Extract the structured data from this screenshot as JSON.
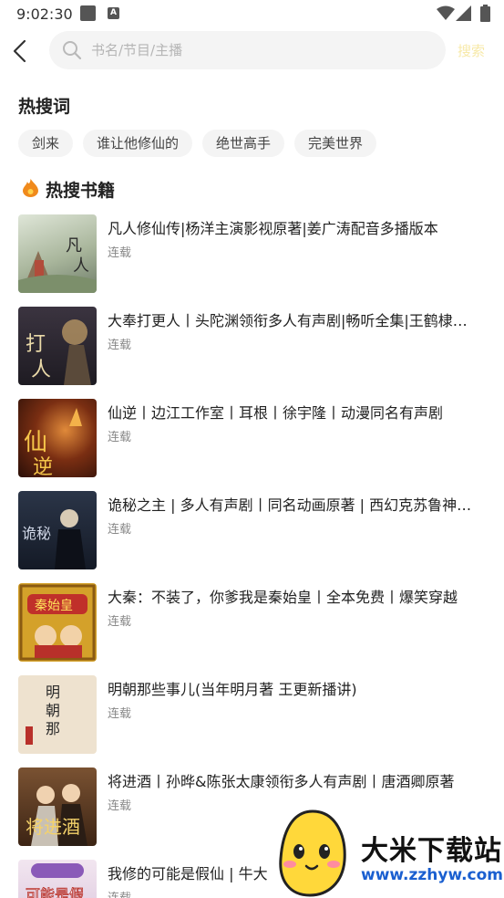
{
  "status_bar": {
    "time": "9:02:30",
    "notification_icons": [
      "square-notification-icon",
      "a-notification-icon"
    ],
    "right_icons": [
      "wifi-icon",
      "signal-icon",
      "battery-icon"
    ]
  },
  "search": {
    "placeholder": "书名/节目/主播",
    "value": "",
    "button_label": "搜索"
  },
  "hot_words": {
    "title": "热搜词",
    "items": [
      "剑来",
      "谁让他修仙的",
      "绝世高手",
      "完美世界"
    ]
  },
  "hot_books": {
    "title": "热搜书籍",
    "items": [
      {
        "title": "凡人修仙传|杨洋主演影视原著|姜广涛配音多播版本",
        "status": "连载",
        "cover_color": "#bcc5b3"
      },
      {
        "title": "大奉打更人丨头陀渊领衔多人有声剧|畅听全集|王鹤棣主演剧集原著",
        "status": "连载",
        "cover_color": "#2e2a33"
      },
      {
        "title": "仙逆丨边江工作室丨耳根丨徐宇隆丨动漫同名有声剧",
        "status": "连载",
        "cover_color": "#3a1d12"
      },
      {
        "title": "诡秘之主 | 多人有声剧丨同名动画原著 | 西幻克苏鲁神秘风格",
        "status": "连载",
        "cover_color": "#1d2535"
      },
      {
        "title": "大秦：不装了，你爹我是秦始皇丨全本免费丨爆笑穿越",
        "status": "连载",
        "cover_color": "#d8a62a"
      },
      {
        "title": "明朝那些事儿(当年明月著 王更新播讲)",
        "status": "连载",
        "cover_color": "#eadcc8"
      },
      {
        "title": "将进酒丨孙晔&陈张太康领衔多人有声剧丨唐酒卿原著",
        "status": "连载",
        "cover_color": "#5a3a22"
      },
      {
        "title": "我修的可能是假仙 | 牛大",
        "status": "连载",
        "cover_color": "#e6d7e8"
      }
    ]
  },
  "watermark": {
    "name": "大米下载站",
    "url": "www.zzhyw.com"
  }
}
